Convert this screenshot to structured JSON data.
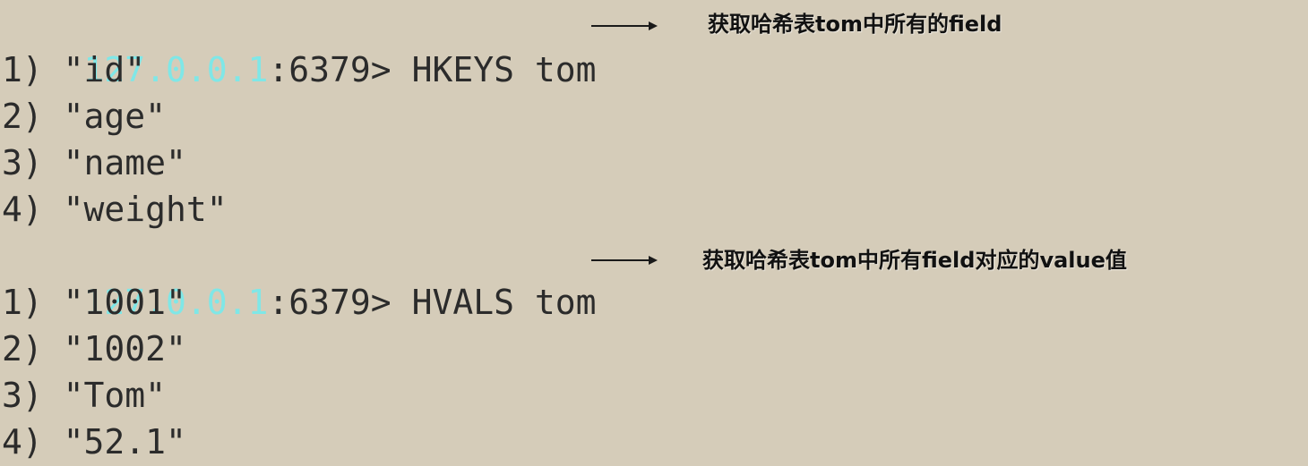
{
  "terminal": {
    "prompt_host": "127.0.0.1",
    "prompt_port": ":6379> ",
    "commands": [
      {
        "command": "HKEYS tom",
        "note": "获取哈希表tom中所有的field",
        "results": [
          "1) \"id\"",
          "2) \"age\"",
          "3) \"name\"",
          "4) \"weight\""
        ]
      },
      {
        "command": "HVALS tom",
        "note": "获取哈希表tom中所有field对应的value值",
        "results": [
          "1) \"1001\"",
          "2) \"1002\"",
          "3) \"Tom\"",
          "4) \"52.1\""
        ]
      }
    ]
  },
  "colors": {
    "background": "#d5ccb9",
    "host": "#7fe7e7",
    "text": "#2b2b2b"
  }
}
